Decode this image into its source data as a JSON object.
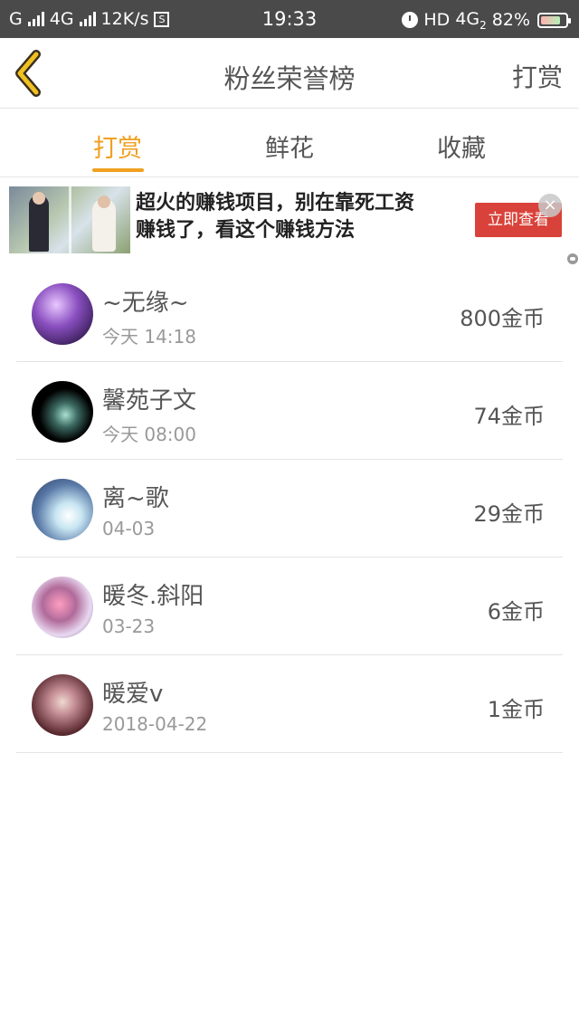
{
  "status_bar": {
    "carrier_left": "G",
    "network": "4G",
    "speed": "12K/s",
    "s_icon": "S",
    "time": "19:33",
    "hd": "HD",
    "network_right": "4G",
    "sim": "2",
    "battery_percent": "82%",
    "battery_level": 0.82
  },
  "header": {
    "title": "粉丝荣誉榜",
    "action": "打赏",
    "back_icon": "chevron-left-icon",
    "accent_color": "#f0a020"
  },
  "tabs": [
    {
      "label": "打赏",
      "active": true
    },
    {
      "label": "鲜花",
      "active": false
    },
    {
      "label": "收藏",
      "active": false
    }
  ],
  "ad": {
    "line1": "超火的赚钱项目，别在靠死工资",
    "line2": "赚钱了，看这个赚钱方法",
    "cta": "立即查看",
    "close": "×"
  },
  "ranking": [
    {
      "name": "~无缘~",
      "time": "今天 14:18",
      "coins": "800金币"
    },
    {
      "name": "馨苑子文",
      "time": "今天 08:00",
      "coins": "74金币"
    },
    {
      "name": "离~歌",
      "time": "04-03",
      "coins": "29金币"
    },
    {
      "name": "暖冬.斜阳",
      "time": "03-23",
      "coins": "6金币"
    },
    {
      "name": "暖爱v",
      "time": "2018-04-22",
      "coins": "1金币"
    }
  ]
}
